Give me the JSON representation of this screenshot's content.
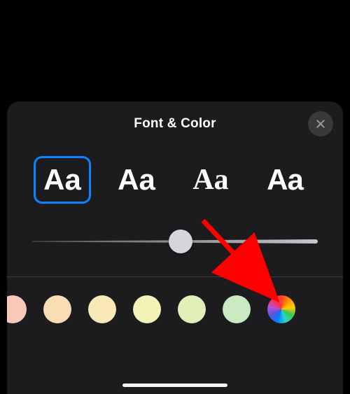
{
  "sheet": {
    "title": "Font & Color",
    "close_icon": "close-icon"
  },
  "fonts": {
    "options": [
      {
        "sample": "Aa",
        "family_class": "ff-sans",
        "selected": true
      },
      {
        "sample": "Aa",
        "family_class": "ff-round",
        "selected": false
      },
      {
        "sample": "Aa",
        "family_class": "ff-serif",
        "selected": false
      },
      {
        "sample": "Aa",
        "family_class": "ff-cond",
        "selected": false
      }
    ]
  },
  "slider": {
    "value_percent": 52
  },
  "colors": {
    "swatches": [
      "#f9c8b8",
      "#f8dcb4",
      "#f6e9b6",
      "#f3f2b7",
      "#e0efb7",
      "#c9e9c0"
    ],
    "has_rainbow_picker": true
  },
  "annotation": {
    "desc": "red arrow pointing to rainbow color picker",
    "color": "#ff0000"
  }
}
